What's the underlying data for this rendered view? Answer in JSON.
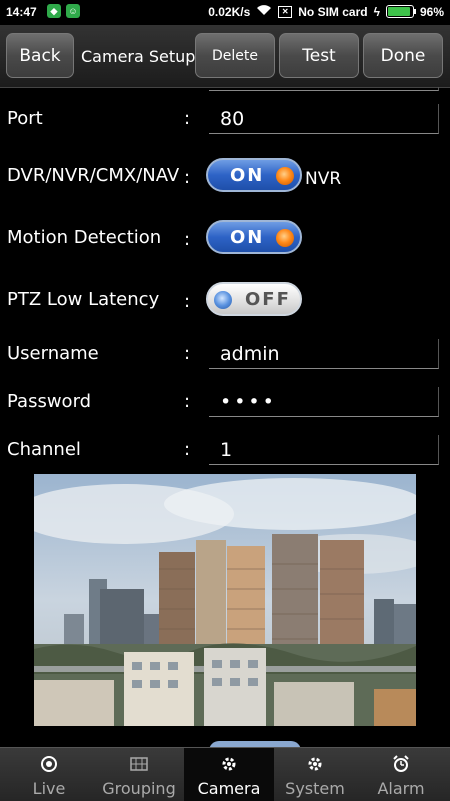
{
  "statusbar": {
    "time": "14:47",
    "network_speed": "0.02K/s",
    "sim": "No SIM card",
    "battery": "96%",
    "battery_level": 0.96
  },
  "toolbar": {
    "back": "Back",
    "title": "Camera Setup",
    "delete": "Delete",
    "test": "Test",
    "done": "Done"
  },
  "form": {
    "colon": ":",
    "port": {
      "label": "Port",
      "value": "80"
    },
    "dvr": {
      "label": "DVR/NVR/CMX/NAV",
      "toggle": "ON",
      "suffix": "NVR"
    },
    "motion": {
      "label": "Motion Detection",
      "toggle": "ON"
    },
    "ptz": {
      "label": "PTZ Low Latency",
      "toggle": "OFF"
    },
    "username": {
      "label": "Username",
      "value": "admin"
    },
    "password": {
      "label": "Password",
      "value": "••••"
    },
    "channel": {
      "label": "Channel",
      "value": "1"
    }
  },
  "nav": {
    "items": [
      {
        "label": "Live",
        "icon": "live-icon"
      },
      {
        "label": "Grouping",
        "icon": "grouping-icon"
      },
      {
        "label": "Camera",
        "icon": "camera-gear-icon",
        "active": true
      },
      {
        "label": "System",
        "icon": "gear-icon"
      },
      {
        "label": "Alarm",
        "icon": "alarm-clock-icon"
      }
    ]
  },
  "colors": {
    "toggle_on": "#2e63c6",
    "toggle_knob_on": "#ff8a1a",
    "battery_green": "#3ec24a"
  }
}
